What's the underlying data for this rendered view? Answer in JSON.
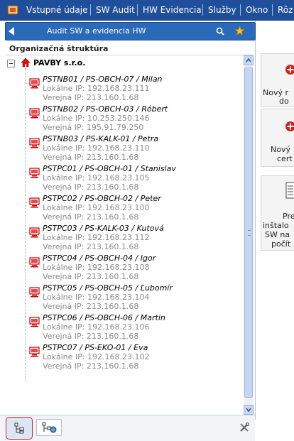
{
  "menu": [
    "Vstupné údaje",
    "SW Audit",
    "HW Evidencia",
    "Služby",
    "Okno",
    "Rôz"
  ],
  "panel": {
    "title": "Audit SW a evidencia HW"
  },
  "org": {
    "header": "Organizačná štruktúra",
    "company": "PAVBY s.r.o."
  },
  "ip_labels": {
    "local": "Lokálne IP:",
    "public": "Verejná IP:"
  },
  "computers": [
    {
      "name": "PSTNB01 / PS-OBCH-07 / Milan",
      "local_ip": "192.168.23.111",
      "public_ip": "213.160.1.68"
    },
    {
      "name": "PSTNB02 / PS-OBCH-03 / Róbert",
      "local_ip": "10.253.250.146",
      "public_ip": "195.91.79.250"
    },
    {
      "name": "PSTNB03 / PS-KALK-01 / Petra",
      "local_ip": "192.168.23.110",
      "public_ip": "213.160.1.68"
    },
    {
      "name": "PSTPC01 / PS-OBCH-01 / Stanislav",
      "local_ip": "192.168.23.105",
      "public_ip": "213.160.1.68"
    },
    {
      "name": "PSTPC02 / PS-OBCH-02 / Peter",
      "local_ip": "192.168.23.100",
      "public_ip": "213.160.1.68"
    },
    {
      "name": "PSTPC03 / PS-KALK-03 / Kutová",
      "local_ip": "192.168.23.112",
      "public_ip": "213.160.1.68"
    },
    {
      "name": "PSTPC04 / PS-OBCH-04 / Igor",
      "local_ip": "192.168.23.108",
      "public_ip": "213.160.1.68"
    },
    {
      "name": "PSTPC05 / PS-OBCH-05 / Ľubomír",
      "local_ip": "192.168.23.104",
      "public_ip": "213.160.1.68"
    },
    {
      "name": "PSTPC06 / PS-OBCH-06 / Martin",
      "local_ip": "192.168.23.106",
      "public_ip": "213.160.1.68"
    },
    {
      "name": "PSTPC07 / PS-EKO-01 / Eva",
      "local_ip": "192.168.23.102",
      "public_ip": "213.160.1.68"
    }
  ],
  "right_cards": [
    {
      "lines": [
        "Nový r",
        "do"
      ],
      "icon": "add-icon"
    },
    {
      "lines": [
        "Nový",
        "cert"
      ],
      "icon": "add-icon"
    },
    {
      "lines": [
        "Pre",
        "inštalo",
        "SW na",
        "počít"
      ],
      "icon": "list-icon"
    }
  ],
  "colors": {
    "menubar": "#1f4f9a",
    "panel_title": "#2a6ab8",
    "accent_red": "#cc0000",
    "ip_gray": "#8a8a8a"
  }
}
